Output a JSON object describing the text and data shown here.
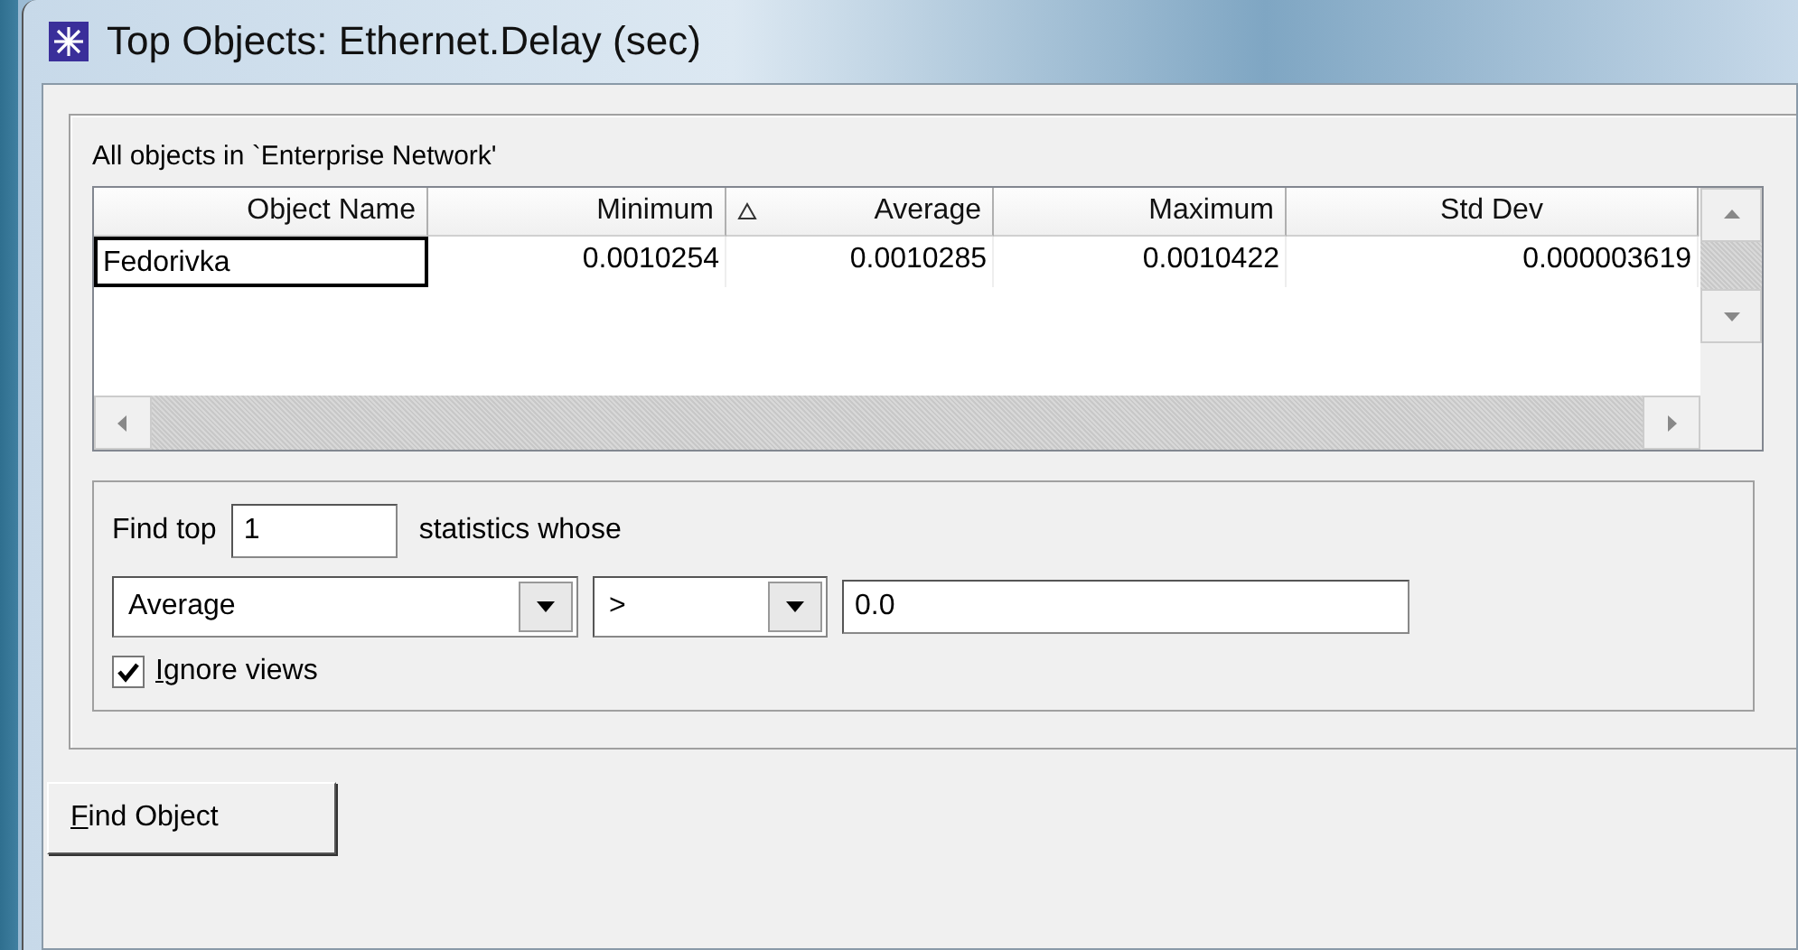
{
  "window": {
    "title": "Top Objects: Ethernet.Delay (sec)"
  },
  "group_label": "All objects in `Enterprise Network'",
  "table": {
    "columns": [
      {
        "label": "Object Name",
        "sorted": false
      },
      {
        "label": "Minimum",
        "sorted": false
      },
      {
        "label": "Average",
        "sorted": true
      },
      {
        "label": "Maximum",
        "sorted": false
      },
      {
        "label": "Std Dev",
        "sorted": false
      }
    ],
    "rows": [
      {
        "focused": true,
        "cells": [
          "Fedorivka",
          "0.0010254",
          "0.0010285",
          "0.0010422",
          "0.000003619"
        ]
      }
    ]
  },
  "filter": {
    "find_top_label": "Find top",
    "count": "1",
    "statistics_label": "statistics whose",
    "field": "Average",
    "operator": ">",
    "value": "0.0",
    "ignore_views": {
      "label": "Ignore views",
      "checked": true
    }
  },
  "buttons": [
    "Find Object"
  ]
}
